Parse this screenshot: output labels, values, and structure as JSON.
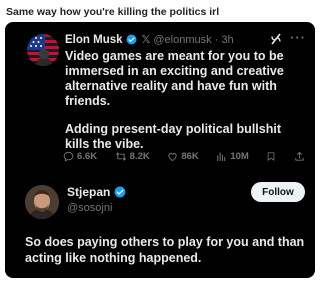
{
  "caption": "Same way how you're killing the politics irl",
  "tweet": {
    "author_name": "Elon Musk",
    "x_mark": "𝕏",
    "handle_time": "@elonmusk · 3h",
    "paragraph_1": "Video games are meant for you to be immersed in an exciting and creative alternative reality and have fun with friends.",
    "paragraph_2": "Adding present-day political bullshit kills the vibe.",
    "more_icon": "more-icon",
    "stats": {
      "replies": "6.6K",
      "reposts": "8.2K",
      "likes": "86K",
      "views": "10M"
    }
  },
  "reply": {
    "author_name": "Stjepan",
    "handle": "@sosojni",
    "follow_label": "Follow",
    "text": "So does paying others to play for you and than acting like nothing happened."
  },
  "colors": {
    "card_bg": "#000000",
    "text": "#e7e9ea",
    "muted": "#71767b",
    "verified_blue": "#1d9bf0",
    "button_bg": "#eff3f4"
  }
}
